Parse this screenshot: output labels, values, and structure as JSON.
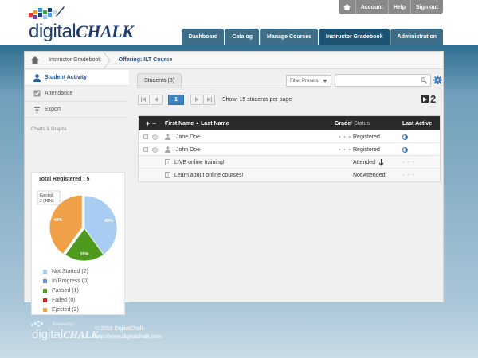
{
  "logo": {
    "word_digital": "digital",
    "word_chalk": "CHALK"
  },
  "utility_nav": {
    "account": "Account",
    "help": "Help",
    "signout": "Sign out"
  },
  "main_nav": [
    "Dashboard",
    "Catalog",
    "Manage Courses",
    "Instructor Gradebook",
    "Administration"
  ],
  "main_nav_active": "Instructor Gradebook",
  "breadcrumb": {
    "gradebook": "Instructor Gradebook",
    "offering": "Offering: ILT Course"
  },
  "sidebar": {
    "items": [
      {
        "label": "Student Activity",
        "icon": "person-icon",
        "active": true
      },
      {
        "label": "Attendance",
        "icon": "checkbox-icon",
        "active": false
      },
      {
        "label": "Export",
        "icon": "export-icon",
        "active": false
      }
    ],
    "section_label": "Charts & Graphs"
  },
  "chart_data": {
    "type": "pie",
    "title": "Total Registered : 5",
    "tooltip": {
      "line1": "Ejected",
      "line2": "2 (40%)"
    },
    "slices": [
      {
        "name": "Not Started",
        "count": 2,
        "percent": 40,
        "color": "#a9cdf2",
        "label": "40%"
      },
      {
        "name": "Passed",
        "count": 1,
        "percent": 20,
        "color": "#4e9a1e",
        "label": "20%"
      },
      {
        "name": "Ejected",
        "count": 2,
        "percent": 40,
        "color": "#f0a046",
        "label": "40%"
      }
    ],
    "legend": [
      {
        "label": "Not Started (2)",
        "color": "#a9cdf2"
      },
      {
        "label": "In Progress (0)",
        "color": "#5c92c8"
      },
      {
        "label": "Passed (1)",
        "color": "#4e9a1e"
      },
      {
        "label": "Failed (0)",
        "color": "#c42a1c"
      },
      {
        "label": "Ejected (2)",
        "color": "#f0a046"
      }
    ]
  },
  "students_tab": {
    "label": "Students",
    "count": "(3)"
  },
  "filter": {
    "label": "Filter Presets"
  },
  "search": {
    "placeholder": ""
  },
  "pager": {
    "current": "1",
    "show_text": "Show: 15 students per page",
    "page_count": "2"
  },
  "table": {
    "headers": {
      "plus": "+",
      "minus": "−",
      "first_name": "First Name",
      "sort_arrow": "▲",
      "last_name": "Last Name",
      "grade": "Grade",
      "status": "/ Status",
      "last_active": "Last Active"
    },
    "rows": [
      {
        "name": "Jane Doe",
        "grade": "- - -",
        "status": "Registered"
      },
      {
        "name": "John Doe",
        "grade": "- - -",
        "status": "Registered"
      }
    ],
    "sub_rows": [
      {
        "name": "LIVE online training!",
        "status": "Attended",
        "last_active": "- - -"
      },
      {
        "name": "Learn about online courses!",
        "status": "Not Attended",
        "last_active": "- - -"
      }
    ]
  },
  "footer": {
    "powered_by": "Powered by",
    "copyright": "© 2016 DigitalChalk",
    "url": "http://www.digitalchalk.com"
  }
}
